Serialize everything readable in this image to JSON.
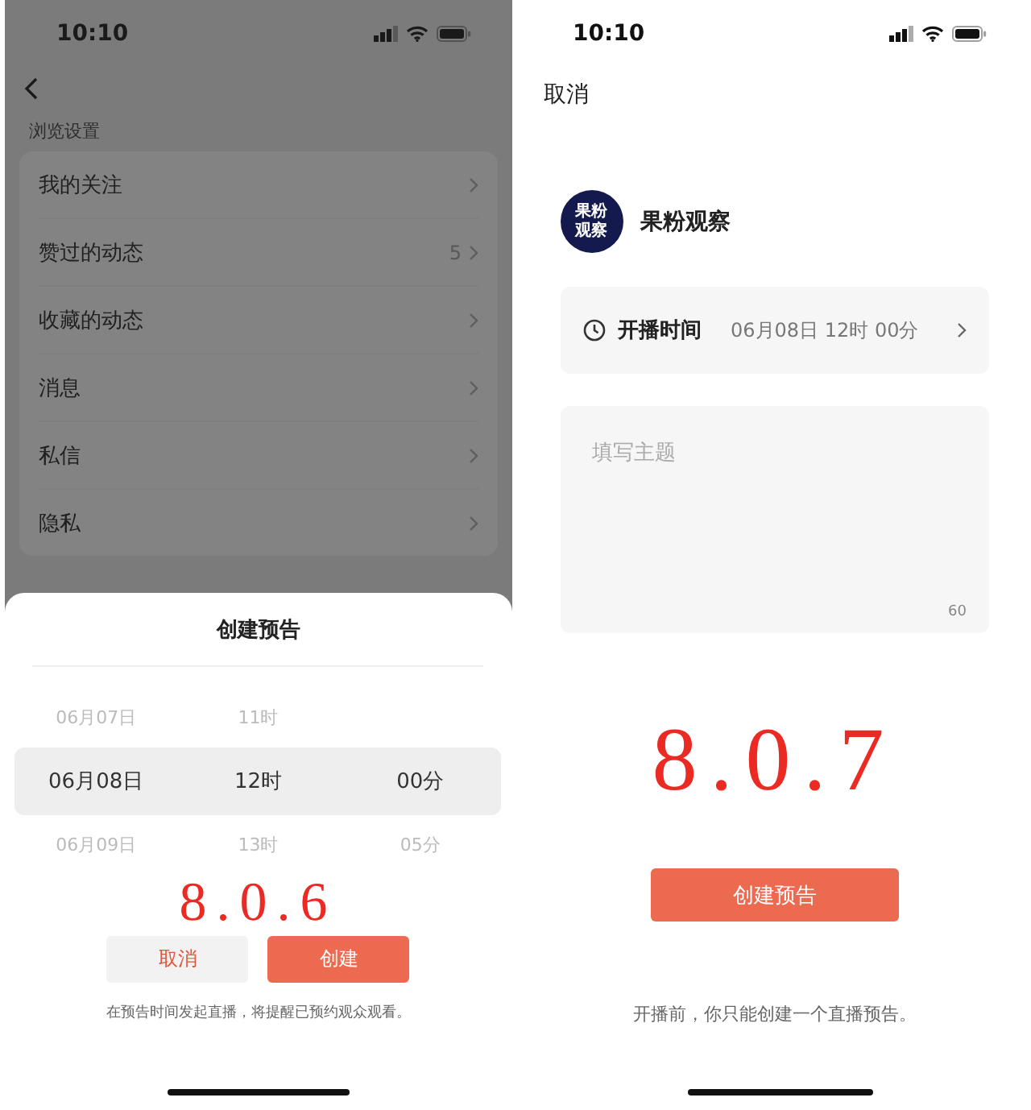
{
  "left_screen": {
    "status_bar": {
      "time": "10:10"
    },
    "section_label": "浏览设置",
    "settings_items": [
      {
        "label": "我的关注"
      },
      {
        "label": "赞过的动态",
        "count": "5"
      },
      {
        "label": "收藏的动态"
      },
      {
        "label": "消息"
      },
      {
        "label": "私信"
      },
      {
        "label": "隐私"
      }
    ],
    "sheet": {
      "title": "创建预告",
      "picker_columns": [
        {
          "items": [
            {
              "label": "06月07日",
              "selected": false
            },
            {
              "label": "06月08日",
              "selected": true
            },
            {
              "label": "06月09日",
              "selected": false
            }
          ]
        },
        {
          "items": [
            {
              "label": "11时",
              "selected": false
            },
            {
              "label": "12时",
              "selected": true
            },
            {
              "label": "13时",
              "selected": false
            }
          ]
        },
        {
          "items": [
            {
              "label": "00分",
              "selected": true
            },
            {
              "label": "05分",
              "selected": false
            }
          ]
        }
      ],
      "buttons": [
        {
          "label": "取消",
          "kind": "secondary"
        },
        {
          "label": "创建",
          "kind": "primary"
        }
      ],
      "note": "在预告时间发起直播，将提醒已预约观众观看。"
    },
    "version_label": "8.0.6"
  },
  "right_screen": {
    "status_bar": {
      "time": "10:10"
    },
    "cancel": "取消",
    "account": {
      "avatar_text": [
        "果粉",
        "观察"
      ],
      "name": "果粉观察"
    },
    "start_time": {
      "label": "开播时间",
      "value": "06月08日 12时 00分"
    },
    "topic": {
      "placeholder": "填写主题",
      "counter": "60"
    },
    "version_label": "8.0.7",
    "button": "创建预告",
    "note": "开播前，你只能创建一个直播预告。"
  }
}
